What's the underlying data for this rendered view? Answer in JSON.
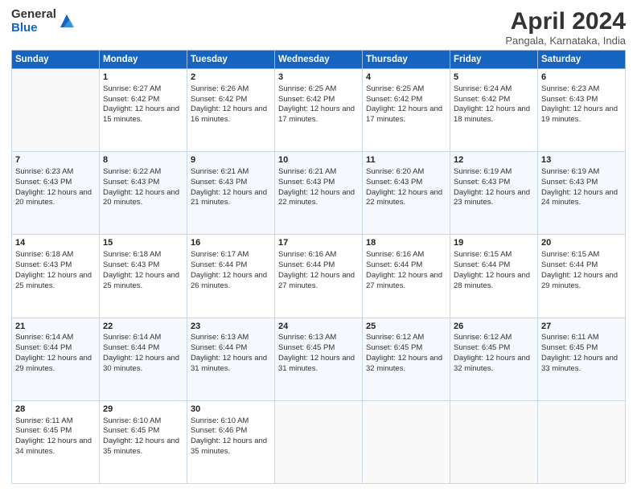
{
  "logo": {
    "general": "General",
    "blue": "Blue"
  },
  "title": "April 2024",
  "subtitle": "Pangala, Karnataka, India",
  "days": [
    "Sunday",
    "Monday",
    "Tuesday",
    "Wednesday",
    "Thursday",
    "Friday",
    "Saturday"
  ],
  "weeks": [
    [
      {
        "day": "",
        "sunrise": "",
        "sunset": "",
        "daylight": ""
      },
      {
        "day": "1",
        "sunrise": "Sunrise: 6:27 AM",
        "sunset": "Sunset: 6:42 PM",
        "daylight": "Daylight: 12 hours and 15 minutes."
      },
      {
        "day": "2",
        "sunrise": "Sunrise: 6:26 AM",
        "sunset": "Sunset: 6:42 PM",
        "daylight": "Daylight: 12 hours and 16 minutes."
      },
      {
        "day": "3",
        "sunrise": "Sunrise: 6:25 AM",
        "sunset": "Sunset: 6:42 PM",
        "daylight": "Daylight: 12 hours and 17 minutes."
      },
      {
        "day": "4",
        "sunrise": "Sunrise: 6:25 AM",
        "sunset": "Sunset: 6:42 PM",
        "daylight": "Daylight: 12 hours and 17 minutes."
      },
      {
        "day": "5",
        "sunrise": "Sunrise: 6:24 AM",
        "sunset": "Sunset: 6:42 PM",
        "daylight": "Daylight: 12 hours and 18 minutes."
      },
      {
        "day": "6",
        "sunrise": "Sunrise: 6:23 AM",
        "sunset": "Sunset: 6:43 PM",
        "daylight": "Daylight: 12 hours and 19 minutes."
      }
    ],
    [
      {
        "day": "7",
        "sunrise": "Sunrise: 6:23 AM",
        "sunset": "Sunset: 6:43 PM",
        "daylight": "Daylight: 12 hours and 20 minutes."
      },
      {
        "day": "8",
        "sunrise": "Sunrise: 6:22 AM",
        "sunset": "Sunset: 6:43 PM",
        "daylight": "Daylight: 12 hours and 20 minutes."
      },
      {
        "day": "9",
        "sunrise": "Sunrise: 6:21 AM",
        "sunset": "Sunset: 6:43 PM",
        "daylight": "Daylight: 12 hours and 21 minutes."
      },
      {
        "day": "10",
        "sunrise": "Sunrise: 6:21 AM",
        "sunset": "Sunset: 6:43 PM",
        "daylight": "Daylight: 12 hours and 22 minutes."
      },
      {
        "day": "11",
        "sunrise": "Sunrise: 6:20 AM",
        "sunset": "Sunset: 6:43 PM",
        "daylight": "Daylight: 12 hours and 22 minutes."
      },
      {
        "day": "12",
        "sunrise": "Sunrise: 6:19 AM",
        "sunset": "Sunset: 6:43 PM",
        "daylight": "Daylight: 12 hours and 23 minutes."
      },
      {
        "day": "13",
        "sunrise": "Sunrise: 6:19 AM",
        "sunset": "Sunset: 6:43 PM",
        "daylight": "Daylight: 12 hours and 24 minutes."
      }
    ],
    [
      {
        "day": "14",
        "sunrise": "Sunrise: 6:18 AM",
        "sunset": "Sunset: 6:43 PM",
        "daylight": "Daylight: 12 hours and 25 minutes."
      },
      {
        "day": "15",
        "sunrise": "Sunrise: 6:18 AM",
        "sunset": "Sunset: 6:43 PM",
        "daylight": "Daylight: 12 hours and 25 minutes."
      },
      {
        "day": "16",
        "sunrise": "Sunrise: 6:17 AM",
        "sunset": "Sunset: 6:44 PM",
        "daylight": "Daylight: 12 hours and 26 minutes."
      },
      {
        "day": "17",
        "sunrise": "Sunrise: 6:16 AM",
        "sunset": "Sunset: 6:44 PM",
        "daylight": "Daylight: 12 hours and 27 minutes."
      },
      {
        "day": "18",
        "sunrise": "Sunrise: 6:16 AM",
        "sunset": "Sunset: 6:44 PM",
        "daylight": "Daylight: 12 hours and 27 minutes."
      },
      {
        "day": "19",
        "sunrise": "Sunrise: 6:15 AM",
        "sunset": "Sunset: 6:44 PM",
        "daylight": "Daylight: 12 hours and 28 minutes."
      },
      {
        "day": "20",
        "sunrise": "Sunrise: 6:15 AM",
        "sunset": "Sunset: 6:44 PM",
        "daylight": "Daylight: 12 hours and 29 minutes."
      }
    ],
    [
      {
        "day": "21",
        "sunrise": "Sunrise: 6:14 AM",
        "sunset": "Sunset: 6:44 PM",
        "daylight": "Daylight: 12 hours and 29 minutes."
      },
      {
        "day": "22",
        "sunrise": "Sunrise: 6:14 AM",
        "sunset": "Sunset: 6:44 PM",
        "daylight": "Daylight: 12 hours and 30 minutes."
      },
      {
        "day": "23",
        "sunrise": "Sunrise: 6:13 AM",
        "sunset": "Sunset: 6:44 PM",
        "daylight": "Daylight: 12 hours and 31 minutes."
      },
      {
        "day": "24",
        "sunrise": "Sunrise: 6:13 AM",
        "sunset": "Sunset: 6:45 PM",
        "daylight": "Daylight: 12 hours and 31 minutes."
      },
      {
        "day": "25",
        "sunrise": "Sunrise: 6:12 AM",
        "sunset": "Sunset: 6:45 PM",
        "daylight": "Daylight: 12 hours and 32 minutes."
      },
      {
        "day": "26",
        "sunrise": "Sunrise: 6:12 AM",
        "sunset": "Sunset: 6:45 PM",
        "daylight": "Daylight: 12 hours and 32 minutes."
      },
      {
        "day": "27",
        "sunrise": "Sunrise: 6:11 AM",
        "sunset": "Sunset: 6:45 PM",
        "daylight": "Daylight: 12 hours and 33 minutes."
      }
    ],
    [
      {
        "day": "28",
        "sunrise": "Sunrise: 6:11 AM",
        "sunset": "Sunset: 6:45 PM",
        "daylight": "Daylight: 12 hours and 34 minutes."
      },
      {
        "day": "29",
        "sunrise": "Sunrise: 6:10 AM",
        "sunset": "Sunset: 6:45 PM",
        "daylight": "Daylight: 12 hours and 35 minutes."
      },
      {
        "day": "30",
        "sunrise": "Sunrise: 6:10 AM",
        "sunset": "Sunset: 6:46 PM",
        "daylight": "Daylight: 12 hours and 35 minutes."
      },
      {
        "day": "",
        "sunrise": "",
        "sunset": "",
        "daylight": ""
      },
      {
        "day": "",
        "sunrise": "",
        "sunset": "",
        "daylight": ""
      },
      {
        "day": "",
        "sunrise": "",
        "sunset": "",
        "daylight": ""
      },
      {
        "day": "",
        "sunrise": "",
        "sunset": "",
        "daylight": ""
      }
    ]
  ]
}
